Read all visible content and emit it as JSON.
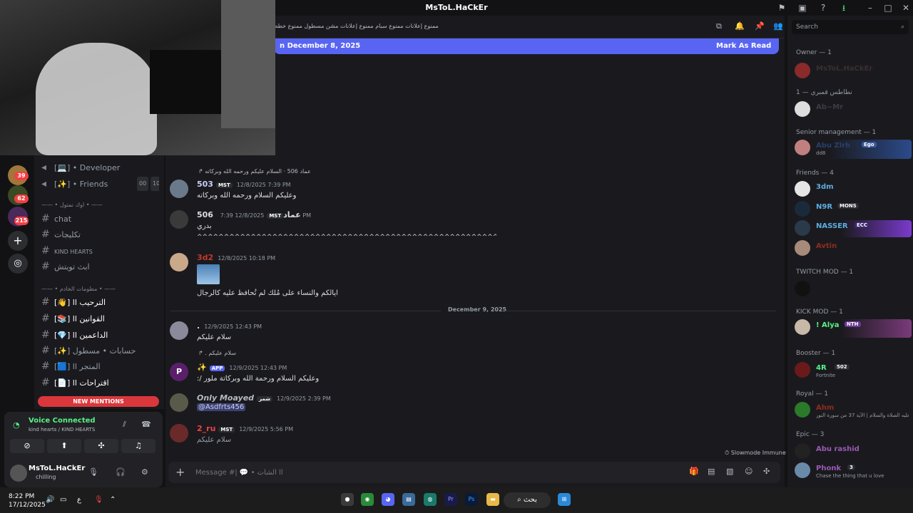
{
  "window": {
    "title": "MsToL.HaCkEr"
  },
  "servers": {
    "badges": [
      "39",
      "62",
      "215"
    ]
  },
  "channels": {
    "items_top": [
      {
        "label": "[💻] • Developer"
      },
      {
        "label": "[✨] • Friends",
        "count_a": "00",
        "count_b": "10"
      }
    ],
    "category1": "—— • اوك نمتول • ——",
    "text_channels": [
      "chat",
      "تكليجات",
      "KIND HEARTS",
      "ابث تويتش"
    ],
    "category2": "—— • مطومات الخادم • ——",
    "server_channels": [
      "[👋] ll الترحيب",
      "[📚] ll القوانين",
      "[💎] ll الداعمين",
      "[✨] حسابات • مسطول",
      "[🟦] ll المتجر",
      "[📄] ll اقتراحات"
    ],
    "new_mentions": "NEW MENTIONS"
  },
  "voice": {
    "status": "Voice Connected",
    "channel": "kind hearts / KIND HEARTS"
  },
  "user": {
    "name": "MsToL.HaCkEr",
    "status": "chilling"
  },
  "header": {
    "topic": "ممنوع إعلانات ممنوع سبام ممنوع إعلانات مشن مسطول ممنوع خطط"
  },
  "unread_banner": {
    "text": "n December 8, 2025",
    "action": "Mark As Read"
  },
  "messages": [
    {
      "reply": "السلام عليكم ورحمه الله وبركاته",
      "reply_user": "عماد 506",
      "user": "503",
      "tag": "MST",
      "time": "12/8/2025 7:39 PM",
      "text": "وعليكم السلام ورحمه الله وبركاته",
      "color": "#c9cdfb"
    },
    {
      "user": "506 عماد",
      "tag": "MST",
      "time": "12/8/2025 7:39 PM",
      "text": "بدري",
      "text2": "^^^^^^^^^^^^^^^^^^^^^^^^^^^^^^^^^^^^^^^^^^^^^^^^^^^^^^^^^^^^^^^^^^^^^^^^^^^^",
      "color": "#dbdee1"
    },
    {
      "user": "3d2",
      "time": "12/8/2025 10:18 PM",
      "text": "ايالكم والنساء على مُلك لم تُحافظ عليه كالرجال",
      "color": "#c0392b"
    },
    {
      "user": ".",
      "time": "12/9/2025 12:43 PM",
      "text": "سلام عليكم",
      "color": "#dbdee1"
    },
    {
      "reply": "سلام عليكم",
      "reply_user": ".",
      "user": "✨",
      "tag": "APP",
      "time": "12/9/2025 12:43 PM",
      "text": "وعليكم السلام ورحمة الله وبركاتة ملور /:",
      "color": "#9b59b6"
    },
    {
      "user": "Only Moayed",
      "tag": "شمر",
      "time": "12/9/2025 2:39 PM",
      "text": "@Asdfrts456",
      "color": "#b5bac1"
    },
    {
      "user": "2_ru",
      "tag": "MST",
      "time": "12/9/2025 5:56 PM",
      "text": "سلام عليكم",
      "color": "#ed4245"
    }
  ],
  "date_divider": "December 9, 2025",
  "slowmode": "Slowmode Immune",
  "composer": {
    "placeholder": "Message #| 💬 • الشات ll"
  },
  "search": {
    "placeholder": "Search"
  },
  "members": {
    "groups": [
      {
        "title": "Owner — 1",
        "members": [
          {
            "name": "MsToL.HaCkEr",
            "color": "#3a2f2f"
          }
        ]
      },
      {
        "title": "نطاطس قمبري — 1",
        "members": [
          {
            "name": "Ab~Mr",
            "color": "#3d3a4a"
          }
        ]
      },
      {
        "title": "Senior management — 1",
        "members": [
          {
            "name": "Abu Zlrh",
            "color": "#2a3f6a",
            "badge": "Ego",
            "sub": "dd8"
          }
        ]
      },
      {
        "title": "Friends — 4",
        "members": [
          {
            "name": "3dm",
            "color": "#5dade2"
          },
          {
            "name": "N9R",
            "color": "#5dade2",
            "badge": "MONS"
          },
          {
            "name": "NASSER",
            "color": "#5dade2",
            "badge": "ECC"
          },
          {
            "name": "Avtin",
            "color": "#922b21"
          }
        ]
      },
      {
        "title": "TWITCH MOD — 1",
        "members": [
          {
            "name": "",
            "color": "#ffffff"
          }
        ]
      },
      {
        "title": "KICK MOD — 1",
        "members": [
          {
            "name": "! Alya",
            "color": "#57f287",
            "badge": "NTH"
          }
        ]
      },
      {
        "title": "Booster — 1",
        "members": [
          {
            "name": "4R",
            "color": "#57f287",
            "badge": "502",
            "sub": "Fortnite"
          }
        ]
      },
      {
        "title": "Royal — 1",
        "members": [
          {
            "name": "Ahm",
            "color": "#922b21",
            "sub": "عليه الصلاة والسلام | الآية 37 من سورة النور"
          }
        ]
      },
      {
        "title": "Epic — 3",
        "members": [
          {
            "name": "Abu rashid",
            "color": "#9b59b6"
          },
          {
            "name": "Phonk",
            "color": "#9b59b6",
            "badge": "3",
            "sub": "Chase the thing that u love"
          }
        ]
      }
    ]
  },
  "taskbar": {
    "time": "8:22 PM",
    "date": "17/12/2025",
    "search": "بحث",
    "lang": "ع"
  }
}
